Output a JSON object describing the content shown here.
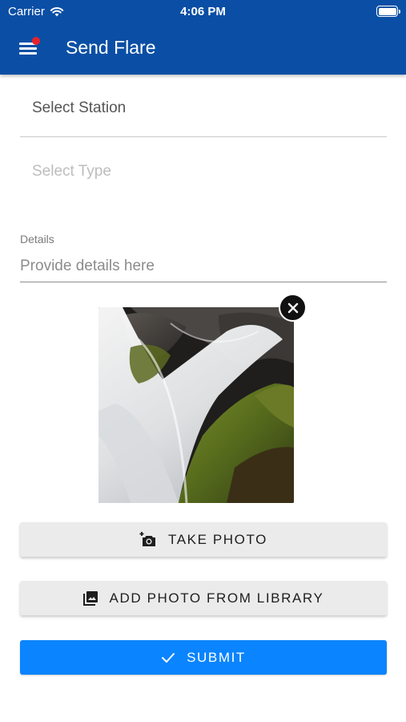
{
  "status_bar": {
    "carrier": "Carrier",
    "time": "4:06 PM"
  },
  "header": {
    "title": "Send Flare",
    "menu_icon": "hamburger-menu-icon",
    "notification_dot_color": "#e8222b"
  },
  "form": {
    "station": {
      "placeholder": "Select Station"
    },
    "type": {
      "placeholder": "Select Type"
    },
    "details": {
      "label": "Details",
      "placeholder": "Provide details here",
      "value": ""
    }
  },
  "photo": {
    "remove_icon": "close-icon"
  },
  "buttons": {
    "take_photo": {
      "label": "TAKE PHOTO",
      "icon": "add-camera-icon"
    },
    "add_from_library": {
      "label": "ADD PHOTO FROM LIBRARY",
      "icon": "photo-library-icon"
    },
    "submit": {
      "label": "SUBMIT",
      "icon": "check-icon"
    }
  },
  "colors": {
    "app_bar": "#0a4fa5",
    "submit": "#0a84ff",
    "secondary_button": "#ebebeb"
  }
}
